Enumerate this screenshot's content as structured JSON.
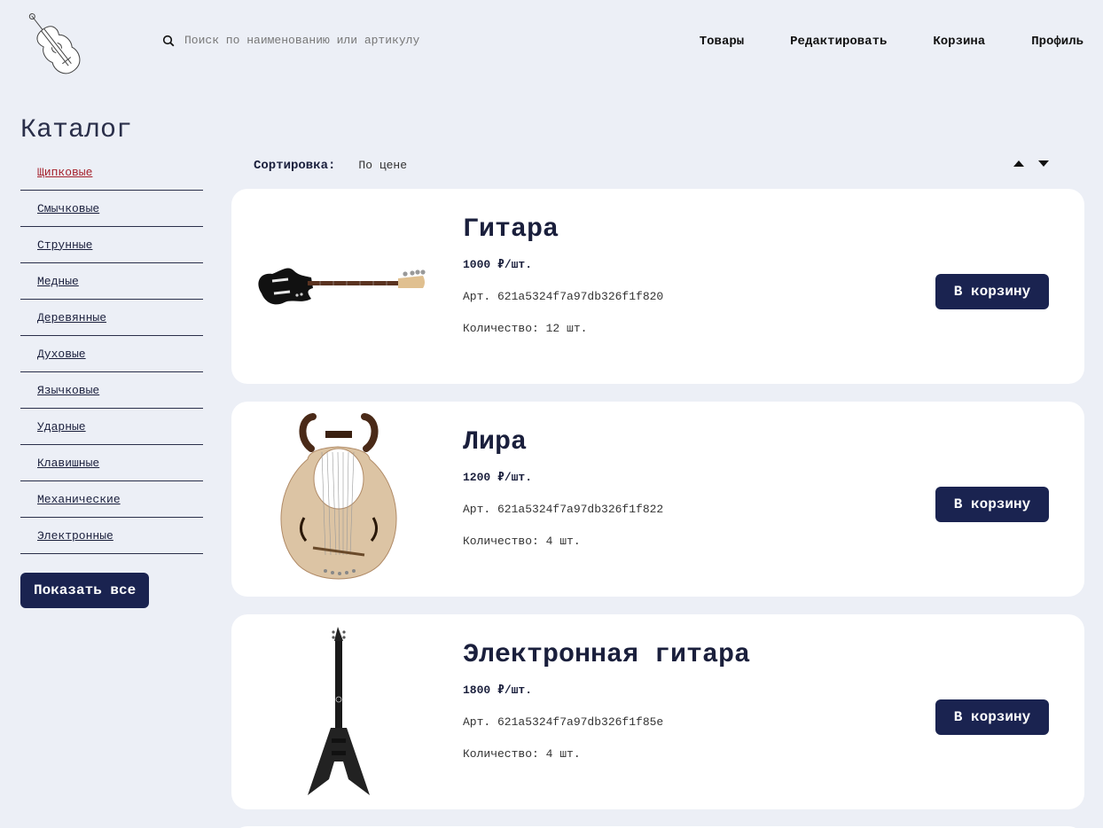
{
  "header": {
    "logo_icon": "violin-logo-icon",
    "search": {
      "icon": "search-icon",
      "placeholder": "Поиск по наименованию или артикулу",
      "value": ""
    },
    "nav": [
      "Товары",
      "Редактировать",
      "Корзина",
      "Профиль"
    ]
  },
  "sidebar": {
    "title": "Каталог",
    "categories": [
      "Щипковые",
      "Смычковые",
      "Струнные",
      "Медные",
      "Деревянные",
      "Духовые",
      "Язычковые",
      "Ударные",
      "Клавишные",
      "Механические",
      "Электронные"
    ],
    "active_category": "Щипковые",
    "show_all_label": "Показать все"
  },
  "sort": {
    "label": "Сортировка:",
    "value": "По цене",
    "up_icon": "sort-ascending-icon",
    "down_icon": "sort-descending-icon"
  },
  "products": [
    {
      "name": "Гитара",
      "price": "1000 ₽/шт.",
      "sku": "Арт. 621a5324f7a97db326f1f820",
      "qty": "Количество: 12 шт.",
      "button": "В корзину",
      "image": "bass-guitar-image"
    },
    {
      "name": "Лира",
      "price": "1200 ₽/шт.",
      "sku": "Арт. 621a5324f7a97db326f1f822",
      "qty": "Количество: 4 шт.",
      "button": "В корзину",
      "image": "lyre-image"
    },
    {
      "name": "Электронная гитара",
      "price": "1800 ₽/шт.",
      "sku": "Арт. 621a5324f7a97db326f1f85e",
      "qty": "Количество: 4 шт.",
      "button": "В корзину",
      "image": "electric-guitar-image"
    }
  ],
  "colors": {
    "background": "#eceff6",
    "accent": "#1a2350",
    "active_link": "#a5212c",
    "card": "#ffffff"
  }
}
